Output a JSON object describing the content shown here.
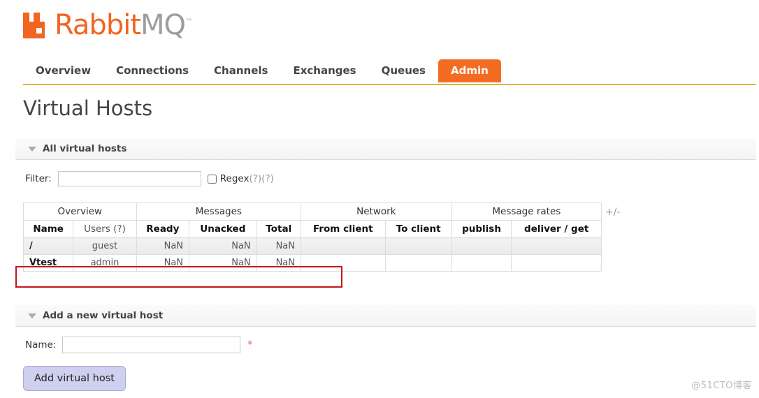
{
  "branding": {
    "logo_rabbit": "Rabbit",
    "logo_mq": "MQ",
    "logo_tm": "™",
    "logo_icon": "rabbitmq-logo-icon",
    "accent_color": "#F26422",
    "active_tab_color": "#F26D21",
    "rule_color": "#E0B43C"
  },
  "nav": {
    "items": [
      {
        "label": "Overview",
        "active": false
      },
      {
        "label": "Connections",
        "active": false
      },
      {
        "label": "Channels",
        "active": false
      },
      {
        "label": "Exchanges",
        "active": false
      },
      {
        "label": "Queues",
        "active": false
      },
      {
        "label": "Admin",
        "active": true
      }
    ]
  },
  "page": {
    "title": "Virtual Hosts"
  },
  "sections": {
    "all_hosts": {
      "title": "All virtual hosts",
      "expanded": true
    },
    "add_host": {
      "title": "Add a new virtual host",
      "expanded": true
    }
  },
  "filter": {
    "label": "Filter:",
    "value": "",
    "placeholder": "",
    "regex_label": "Regex",
    "regex_checked": false,
    "help_1": "(?)",
    "help_2": "(?)"
  },
  "table": {
    "group_headers": [
      {
        "label": "Overview",
        "span": 2
      },
      {
        "label": "Messages",
        "span": 3
      },
      {
        "label": "Network",
        "span": 2
      },
      {
        "label": "Message rates",
        "span": 2
      }
    ],
    "columns": [
      "Name",
      "Users (?)",
      "Ready",
      "Unacked",
      "Total",
      "From client",
      "To client",
      "publish",
      "deliver / get"
    ],
    "rows": [
      {
        "name": "/",
        "users": "guest",
        "ready": "NaN",
        "unacked": "NaN",
        "total": "NaN",
        "from_client": "",
        "to_client": "",
        "publish": "",
        "deliver_get": ""
      },
      {
        "name": "Vtest",
        "users": "admin",
        "ready": "NaN",
        "unacked": "NaN",
        "total": "NaN",
        "from_client": "",
        "to_client": "",
        "publish": "",
        "deliver_get": ""
      }
    ],
    "column_toggle": "+/-"
  },
  "annotation": {
    "color": "#C4161C",
    "target_row": "Vtest"
  },
  "add_form": {
    "name_label": "Name:",
    "name_value": "",
    "name_placeholder": "",
    "required_marker": "*",
    "submit_label": "Add virtual host"
  },
  "watermark": {
    "text": "@51CTO博客"
  }
}
